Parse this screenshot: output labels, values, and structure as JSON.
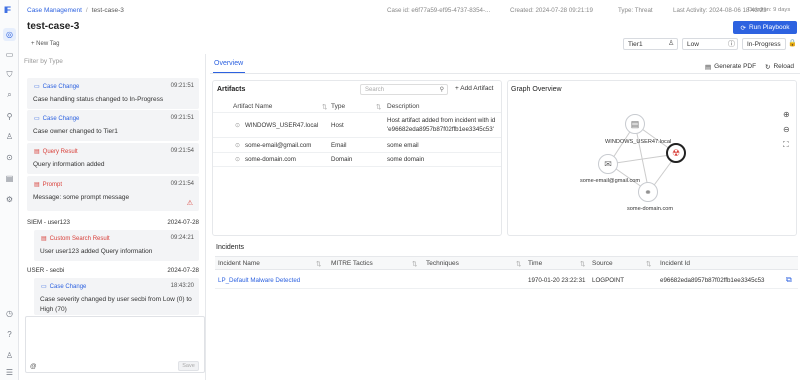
{
  "app": {
    "logo": "IF"
  },
  "breadcrumb": {
    "parent": "Case Management",
    "separator": "/",
    "current": "test-case-3"
  },
  "case": {
    "title": "test-case-3",
    "new_tag": "+ New Tag",
    "meta_id": "Case id: e6f77a59-ef95-4737-8354-...",
    "meta_created": "Created: 2024-07-28 09:21:19",
    "meta_type": "Type: Threat",
    "meta_activity": "Last Activity: 2024-08-06 18:43:23",
    "meta_duration": "Duration: 9 days",
    "run_playbook": "Run Playbook",
    "tier": "Tier1",
    "severity": "Low",
    "status": "In-Progress"
  },
  "timeline": {
    "filter_placeholder": "Filter by Type",
    "items": [
      {
        "type": "Case Change",
        "time": "09:21:51",
        "msg": "Case handling status changed to In-Progress"
      },
      {
        "type": "Case Change",
        "time": "09:21:51",
        "msg": "Case owner changed to Tier1"
      },
      {
        "type": "Query Result",
        "time": "09:21:54",
        "msg": "Query information added"
      },
      {
        "type": "Prompt",
        "time": "09:21:54",
        "msg": "Message: some prompt message"
      },
      {
        "type": "Custom Search Result",
        "time": "09:24:21",
        "msg": "User user123 added Query information"
      },
      {
        "type": "Case Change",
        "time": "18:43:20",
        "msg": "Case severity changed by user secbi from Low (0) to High (70)"
      }
    ],
    "groups": [
      {
        "name": "SIEM - user123",
        "date": "2024-07-28"
      },
      {
        "name": "USER - secbi",
        "date": "2024-07-28"
      }
    ],
    "comment_at": "@",
    "save_label": "Save"
  },
  "overview": {
    "tab": "Overview",
    "generate_pdf": "Generate PDF",
    "reload": "Reload"
  },
  "artifacts": {
    "title": "Artifacts",
    "search_placeholder": "Search",
    "add_label": "Add Artifact",
    "columns": [
      "Artifact Name",
      "Type",
      "Description"
    ],
    "rows": [
      {
        "name": "WINDOWS_USER47.local",
        "type": "Host",
        "desc": "Host artifact added from incident with id 'e96682eda8957b87f02ffb1ee3345c53'"
      },
      {
        "name": "some-email@gmail.com",
        "type": "Email",
        "desc": "some email"
      },
      {
        "name": "some-domain.com",
        "type": "Domain",
        "desc": "some domain"
      }
    ]
  },
  "graph": {
    "title": "Graph Overview",
    "nodes": {
      "host": "WINDOWS_USER47.local",
      "email": "some-email@gmail.com",
      "domain": "some-domain.com"
    }
  },
  "incidents": {
    "title": "Incidents",
    "columns": [
      "Incident Name",
      "MITRE Tactics",
      "Techniques",
      "Time",
      "Source",
      "Incident Id"
    ],
    "rows": [
      {
        "name": "LP_Default Malware Detected",
        "tactics": "",
        "techniques": "",
        "time": "1970-01-20 23:22:31",
        "source": "LOGPOINT",
        "id": "e96682eda8957b87f02ffb1ee3345c53"
      }
    ]
  },
  "colors": {
    "accent": "#2d62e0",
    "danger": "#d9403a"
  }
}
